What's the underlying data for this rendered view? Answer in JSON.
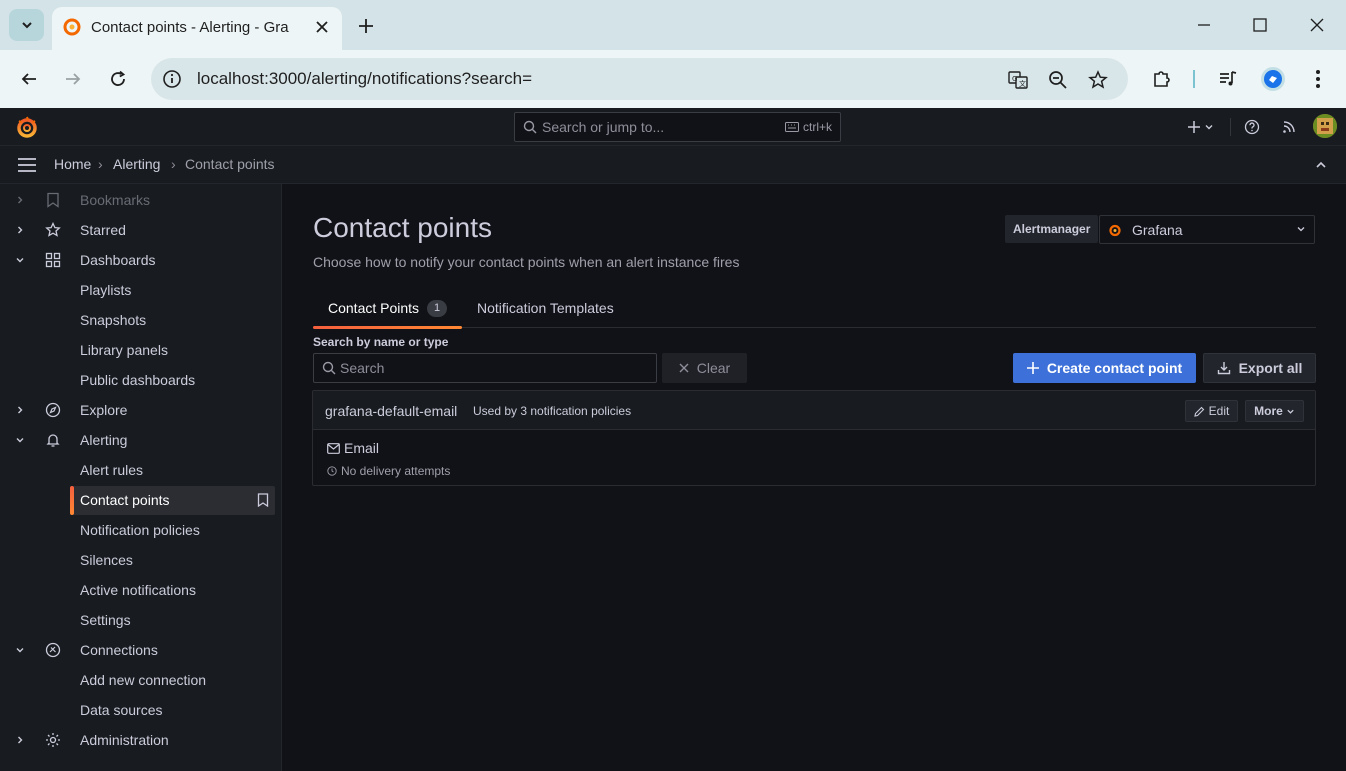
{
  "browser": {
    "tab_title": "Contact points - Alerting - Gra",
    "url": "localhost:3000/alerting/notifications?search="
  },
  "topbar": {
    "search_placeholder": "Search or jump to...",
    "shortcut": "ctrl+k"
  },
  "breadcrumb": {
    "items": [
      "Home",
      "Alerting",
      "Contact points"
    ]
  },
  "sidebar": {
    "items": [
      {
        "label": "Bookmarks",
        "icon": "bookmark-icon",
        "expandable": true,
        "expanded": false
      },
      {
        "label": "Starred",
        "icon": "star-icon",
        "expandable": true,
        "expanded": false
      },
      {
        "label": "Dashboards",
        "icon": "apps-icon",
        "expandable": true,
        "expanded": true
      },
      {
        "label": "Playlists"
      },
      {
        "label": "Snapshots"
      },
      {
        "label": "Library panels"
      },
      {
        "label": "Public dashboards"
      },
      {
        "label": "Explore",
        "icon": "compass-icon",
        "expandable": true,
        "expanded": false
      },
      {
        "label": "Alerting",
        "icon": "bell-icon",
        "expandable": true,
        "expanded": true
      },
      {
        "label": "Alert rules"
      },
      {
        "label": "Contact points",
        "active": true
      },
      {
        "label": "Notification policies"
      },
      {
        "label": "Silences"
      },
      {
        "label": "Active notifications"
      },
      {
        "label": "Settings"
      },
      {
        "label": "Connections",
        "icon": "connections-icon",
        "expandable": true,
        "expanded": true
      },
      {
        "label": "Add new connection"
      },
      {
        "label": "Data sources"
      },
      {
        "label": "Administration",
        "icon": "cog-icon",
        "expandable": true,
        "expanded": false
      }
    ]
  },
  "page": {
    "title": "Contact points",
    "subtitle": "Choose how to notify your contact points when an alert instance fires",
    "alertmanager_label": "Alertmanager",
    "alertmanager_value": "Grafana"
  },
  "tabs": [
    {
      "label": "Contact Points",
      "count": "1",
      "active": true
    },
    {
      "label": "Notification Templates",
      "active": false
    }
  ],
  "filters": {
    "search_label": "Search by name or type",
    "search_placeholder": "Search",
    "clear_label": "Clear",
    "create_label": "Create contact point",
    "export_label": "Export all"
  },
  "contact_points": [
    {
      "name": "grafana-default-email",
      "used_by": "Used by 3 notification policies",
      "edit_label": "Edit",
      "more_label": "More",
      "integration": "Email",
      "status": "No delivery attempts"
    }
  ],
  "colors": {
    "primary_button": "#3d71d9",
    "active_accent": "#ff8833",
    "background": "#111217",
    "panel": "#181b1f"
  }
}
